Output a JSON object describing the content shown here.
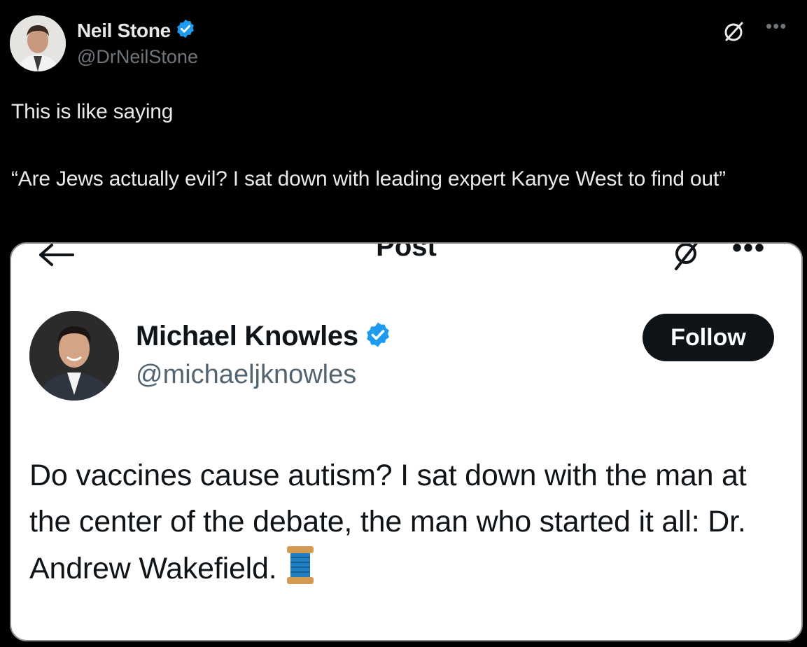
{
  "outer_tweet": {
    "author_name": "Neil Stone",
    "handle": "@DrNeilStone",
    "verified": true,
    "text": "This is like saying\n\n“Are Jews actually evil? I sat down with leading expert Kanye West to find out”",
    "icons": [
      "grok-icon",
      "more-options-icon"
    ]
  },
  "embedded_screenshot": {
    "header": {
      "back_icon": "back-arrow-icon",
      "title": "Post",
      "icons": [
        "grok-icon",
        "more-options-icon"
      ]
    },
    "author_name": "Michael Knowles",
    "handle": "@michaeljknowles",
    "verified": true,
    "follow_label": "Follow",
    "text": "Do vaccines cause autism? I sat down with the man at the center of the debate, the man who started it all: Dr. Andrew Wakefield.",
    "trailing_emoji_icon": "thread-spool-icon"
  },
  "colors": {
    "background": "#000000",
    "verified_badge": "#1d9bf0",
    "card_background": "#ffffff",
    "follow_button": "#0f1419"
  }
}
